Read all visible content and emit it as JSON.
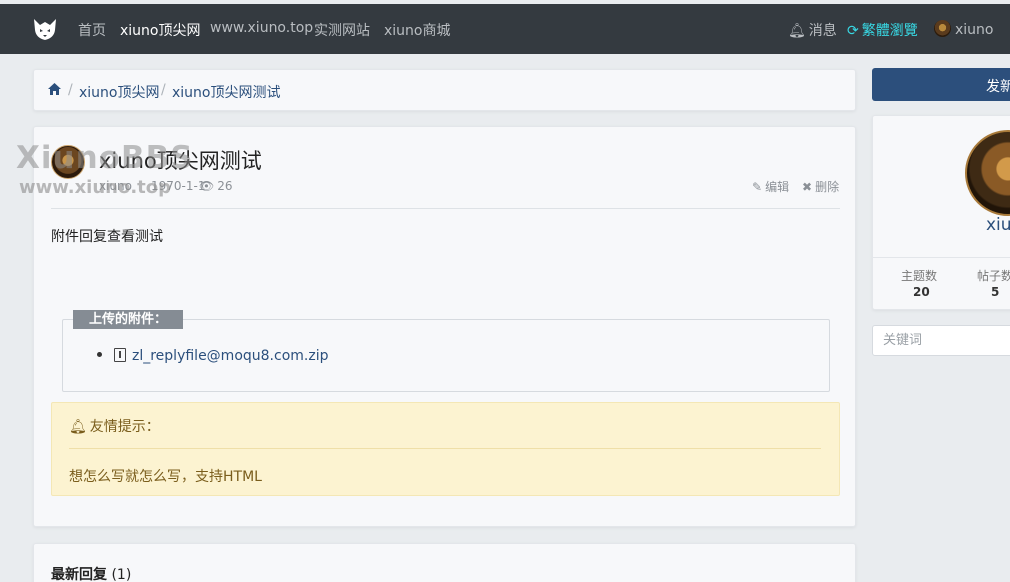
{
  "nav": {
    "items": [
      "首页",
      "xiuno顶尖网",
      "www.xiuno.top",
      "实测网站",
      "xiuno商城"
    ],
    "messages": "消息",
    "traditional": "繁體瀏覽",
    "user": "xiuno"
  },
  "breadcrumb": {
    "forum": "xiuno顶尖网",
    "thread": "xiuno顶尖网测试"
  },
  "thread": {
    "title": "xiuno顶尖网测试",
    "author": "xiuno",
    "date": "1970-1-1",
    "views": "26",
    "edit_label": "编辑",
    "delete_label": "删除",
    "body": "附件回复查看测试",
    "attachments_legend": "上传的附件：",
    "attachment_file": "zl_replyfile@moqu8.com.zip",
    "tip_title": "友情提示：",
    "tip_body": "想怎么写就怎么写，支持HTML"
  },
  "replies": {
    "title": "最新回复",
    "count": "(1)"
  },
  "sidebar": {
    "post_button": "发新",
    "username": "xiuno",
    "topics_label": "主题数",
    "topics_value": "20",
    "posts_label": "帖子数",
    "posts_value": "5",
    "search_placeholder": "关键词"
  },
  "watermark": {
    "line1": "XiunoBBS",
    "line2": "www.xiuno.top"
  },
  "colors": {
    "navbar": "#343a40",
    "accent_link": "#2b4f7c",
    "traditional_link": "#38d9e5",
    "tip_bg": "#fcf3d1"
  }
}
